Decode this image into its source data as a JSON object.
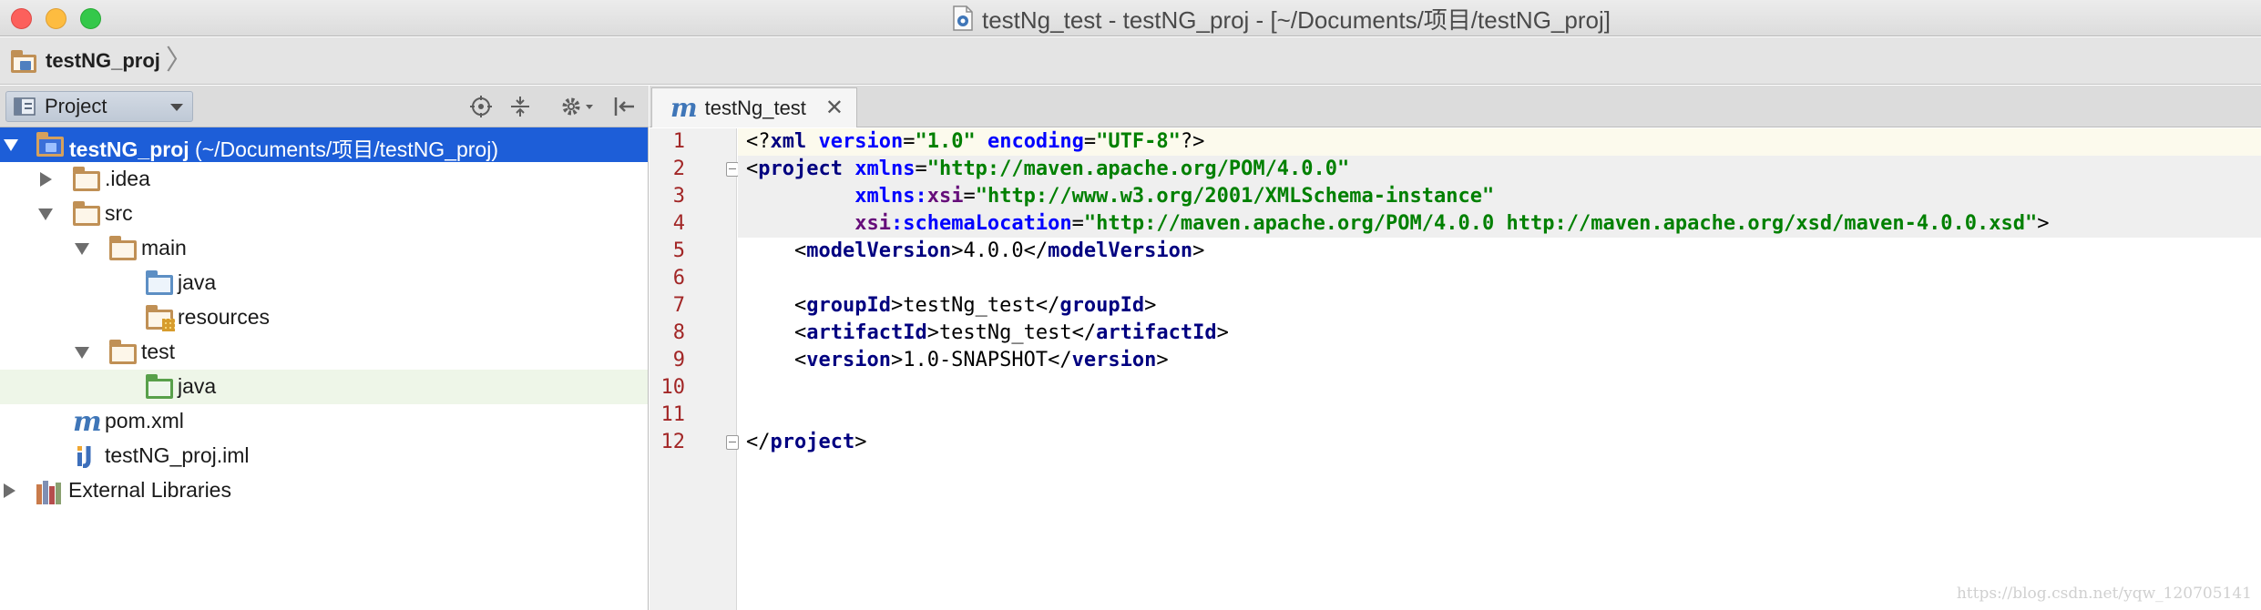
{
  "window": {
    "title": "testNg_test - testNG_proj - [~/Documents/项目/testNG_proj]"
  },
  "navbar": {
    "project": "testNG_proj"
  },
  "project_panel": {
    "view_selector": "Project",
    "tree": [
      {
        "label": "testNG_proj",
        "path": " (~/Documents/项目/testNG_proj)",
        "expanded": true,
        "selected": true
      },
      {
        "label": ".idea",
        "expanded": false
      },
      {
        "label": "src",
        "expanded": true
      },
      {
        "label": "main",
        "expanded": true
      },
      {
        "label": "java"
      },
      {
        "label": "resources"
      },
      {
        "label": "test",
        "expanded": true
      },
      {
        "label": "java",
        "hovered": true
      },
      {
        "label": "pom.xml"
      },
      {
        "label": "testNG_proj.iml"
      },
      {
        "label": "External Libraries",
        "expanded": false
      }
    ]
  },
  "editor": {
    "tab": {
      "label": "testNg_test",
      "close": "✕",
      "icon": "m"
    },
    "line_numbers": [
      "1",
      "2",
      "3",
      "4",
      "5",
      "6",
      "7",
      "8",
      "9",
      "10",
      "11",
      "12"
    ],
    "code": {
      "l1": {
        "a": "<?",
        "b": "xml",
        "c": " ",
        "d": "version",
        "e": "=",
        "f": "\"1.0\"",
        "g": " ",
        "h": "encoding",
        "i": "=",
        "j": "\"UTF-8\"",
        "k": "?>"
      },
      "l2": {
        "a": "<",
        "b": "project",
        "c": " ",
        "d": "xmlns",
        "e": "=",
        "f": "\"http://maven.apache.org/POM/4.0.0\""
      },
      "l3": {
        "indent": "         ",
        "a": "xmlns",
        "b": ":",
        "c": "xsi",
        "d": "=",
        "e": "\"http://www.w3.org/2001/XMLSchema-instance\""
      },
      "l4": {
        "indent": "         ",
        "a": "xsi",
        "b": ":",
        "c": "schemaLocation",
        "d": "=",
        "e": "\"http://maven.apache.org/POM/4.0.0 http://maven.apache.org/xsd/maven-4.0.0.xsd\"",
        "f": ">"
      },
      "l5": {
        "indent": "    ",
        "a": "<",
        "b": "modelVersion",
        "c": ">",
        "d": "4.0.0",
        "e": "</",
        "f": "modelVersion",
        "g": ">"
      },
      "l7": {
        "indent": "    ",
        "a": "<",
        "b": "groupId",
        "c": ">",
        "d": "testNg_test",
        "e": "</",
        "f": "groupId",
        "g": ">"
      },
      "l8": {
        "indent": "    ",
        "a": "<",
        "b": "artifactId",
        "c": ">",
        "d": "testNg_test",
        "e": "</",
        "f": "artifactId",
        "g": ">"
      },
      "l9": {
        "indent": "    ",
        "a": "<",
        "b": "version",
        "c": ">",
        "d": "1.0-SNAPSHOT",
        "e": "</",
        "f": "version",
        "g": ">"
      },
      "l12": {
        "a": "</",
        "b": "project",
        "c": ">"
      }
    }
  },
  "watermark": "https://blog.csdn.net/yqw_120705141",
  "icons": {
    "close": "close-icon",
    "minimize": "minimize-icon",
    "maximize": "maximize-icon",
    "locate": "locate-icon",
    "collapse": "collapse-all-icon",
    "settings": "gear-icon",
    "hide": "hide-panel-icon"
  },
  "colors": {
    "selection": "#1d5ed8",
    "keyword": "#000080",
    "attribute": "#0000ff",
    "string": "#008000",
    "line_number": "#a22626"
  }
}
